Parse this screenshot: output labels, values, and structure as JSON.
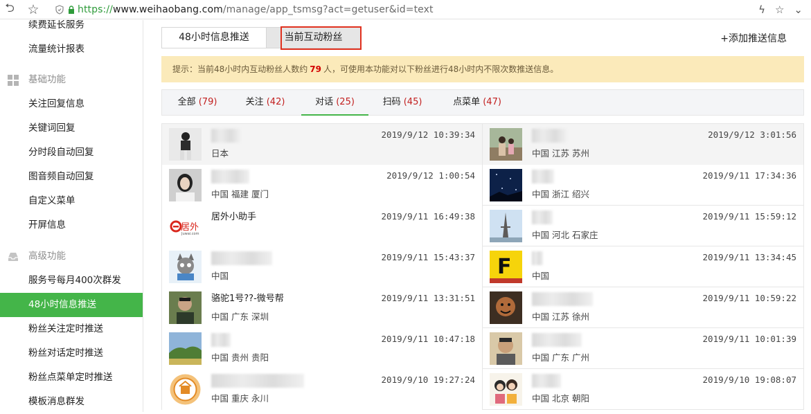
{
  "browser": {
    "url_proto": "https://",
    "url_host": "www.weihaobang.com",
    "url_path": "/manage/app_tsmsg?act=getuser&id=text"
  },
  "sidebar": {
    "items_top": [
      {
        "label": "续费延长服务"
      },
      {
        "label": "流量统计报表"
      }
    ],
    "group_basic": "基础功能",
    "items_basic": [
      {
        "label": "关注回复信息"
      },
      {
        "label": "关键词回复"
      },
      {
        "label": "分时段自动回复"
      },
      {
        "label": "图音频自动回复"
      },
      {
        "label": "自定义菜单"
      },
      {
        "label": "开屏信息"
      }
    ],
    "group_advanced": "高级功能",
    "items_advanced": [
      {
        "label": "服务号每月400次群发"
      },
      {
        "label": "48小时信息推送",
        "active": true
      },
      {
        "label": "粉丝关注定时推送"
      },
      {
        "label": "粉丝对话定时推送"
      },
      {
        "label": "粉丝点菜单定时推送"
      },
      {
        "label": "模板消息群发"
      }
    ]
  },
  "main": {
    "tab_push": "48小时信息推送",
    "tab_fans": "当前互动粉丝",
    "add_push": "+添加推送信息",
    "notice_prefix": "提示：当前48小时内互动粉丝人数约",
    "notice_count": "79",
    "notice_suffix": "人，可使用本功能对以下粉丝进行48小时内不限次数推送信息。",
    "filters": [
      {
        "label": "全部",
        "count": "(79)"
      },
      {
        "label": "关注",
        "count": "(42)"
      },
      {
        "label": "对话",
        "count": "(25)",
        "active": true
      },
      {
        "label": "扫码",
        "count": "(45)"
      },
      {
        "label": "点菜单",
        "count": "(47)"
      }
    ],
    "fans": [
      {
        "nick": "",
        "loc": "日本",
        "time": "2019/9/12 10:39:34"
      },
      {
        "nick": "",
        "loc": "中国 江苏 苏州",
        "time": "2019/9/12 3:01:56"
      },
      {
        "nick": "",
        "loc": "中国 福建 厦门",
        "time": "2019/9/12 1:00:54"
      },
      {
        "nick": "",
        "loc": "中国 浙江 绍兴",
        "time": "2019/9/11 17:34:36"
      },
      {
        "nick": "居外小助手",
        "loc": "",
        "time": "2019/9/11 16:49:38"
      },
      {
        "nick": "",
        "loc": "中国 河北 石家庄",
        "time": "2019/9/11 15:59:12"
      },
      {
        "nick": "",
        "loc": "中国",
        "time": "2019/9/11 15:43:37"
      },
      {
        "nick": "",
        "loc": "中国",
        "time": "2019/9/11 13:34:45"
      },
      {
        "nick": "骆驼1号??-微号帮",
        "loc": "中国 广东 深圳",
        "time": "2019/9/11 13:31:51"
      },
      {
        "nick": "",
        "loc": "中国 江苏 徐州",
        "time": "2019/9/11 10:59:22"
      },
      {
        "nick": "",
        "loc": "中国 贵州 贵阳",
        "time": "2019/9/11 10:47:18"
      },
      {
        "nick": "",
        "loc": "中国 广东 广州",
        "time": "2019/9/11 10:01:39"
      },
      {
        "nick": "",
        "loc": "中国 重庆 永川",
        "time": "2019/9/10 19:27:24"
      },
      {
        "nick": "",
        "loc": "中国 北京 朝阳",
        "time": "2019/9/10 19:08:07"
      }
    ],
    "logo_juwai_text": "居外",
    "logo_juwai_sub": "Juwai.com",
    "logo_f_text": "F"
  }
}
